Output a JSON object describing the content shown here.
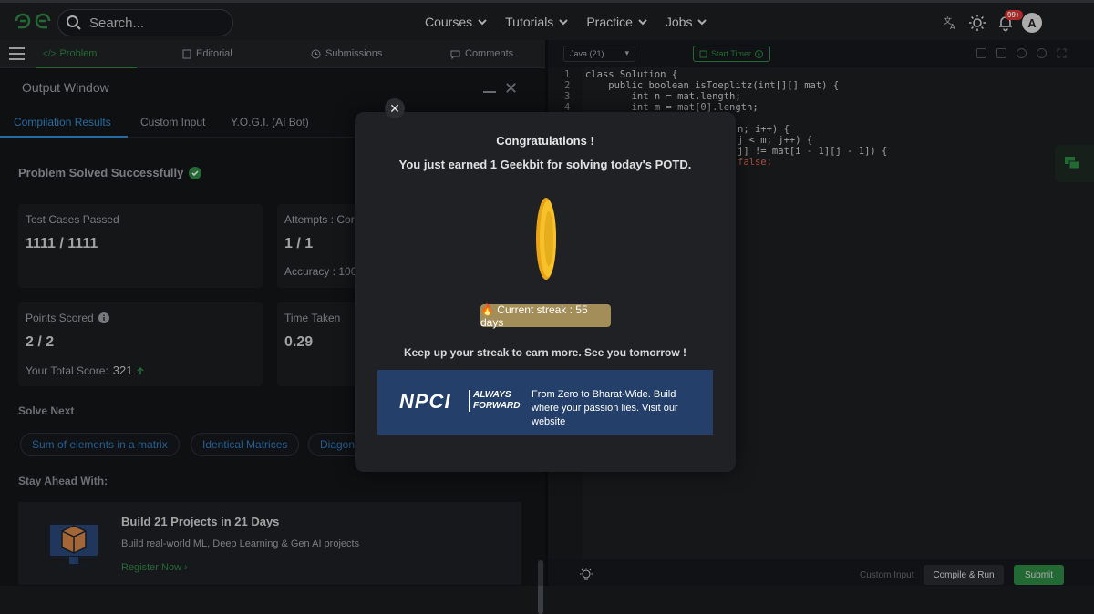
{
  "topnav": {
    "search_placeholder": "Search...",
    "menu": [
      "Courses",
      "Tutorials",
      "Practice",
      "Jobs"
    ],
    "notification_badge": "99+",
    "avatar_initial": "A"
  },
  "problem_tabs": {
    "problem": "Problem",
    "editorial": "Editorial",
    "submissions": "Submissions",
    "comments": "Comments"
  },
  "output": {
    "title": "Output Window",
    "tabs": [
      "Compilation Results",
      "Custom Input",
      "Y.O.G.I. (AI Bot)"
    ],
    "status": "Problem Solved Successfully",
    "cards": {
      "tests_label": "Test Cases Passed",
      "tests_value": "1111 / 1111",
      "attempts_label": "Attempts : Corr",
      "attempts_value": "1 / 1",
      "accuracy": "Accuracy : 100",
      "points_label": "Points Scored",
      "points_value": "2 / 2",
      "total_score_label": "Your Total Score:",
      "total_score_value": "321",
      "time_label": "Time Taken",
      "time_value": "0.29"
    },
    "solve_next_label": "Solve Next",
    "solve_next": [
      "Sum of elements in a matrix",
      "Identical Matrices",
      "Diagon"
    ],
    "stay_ahead": "Stay Ahead With:",
    "promo": {
      "title": "Build 21 Projects in 21 Days",
      "subtitle": "Build real-world ML, Deep Learning & Gen AI projects",
      "link": "Register Now ›"
    }
  },
  "editor": {
    "language": "Java (21)",
    "timer": "Start Timer",
    "line_numbers": [
      "1",
      "2",
      "3",
      "4"
    ],
    "lines": [
      "class Solution {",
      "    public boolean isToeplitz(int[][] mat) {",
      "        int n = mat.length;",
      "        int m = mat[0].length;"
    ],
    "partial_lines": [
      "n; i++) {",
      "j < m; j++) {",
      "j] != mat[i - 1][j - 1]) {",
      "false;"
    ],
    "custom_input": "Custom Input",
    "compile_run": "Compile & Run",
    "submit": "Submit"
  },
  "modal": {
    "title": "Congratulations !",
    "message": "You just earned 1 Geekbit for solving today's POTD.",
    "streak": "🔥 Current streak : 55 days",
    "keep_up": "Keep up your streak to earn more. See you tomorrow !",
    "ad_logo": "NPCI",
    "ad_tagline_1": "ALWAYS",
    "ad_tagline_2": "FORWARD",
    "ad_text": "From Zero to Bharat-Wide. Build where your passion lies. Visit our website"
  },
  "colors": {
    "brand_green": "#2f8d46",
    "link_blue": "#2f8fd6",
    "streak_gold": "#a38d58",
    "ad_blue": "#233f6a"
  }
}
